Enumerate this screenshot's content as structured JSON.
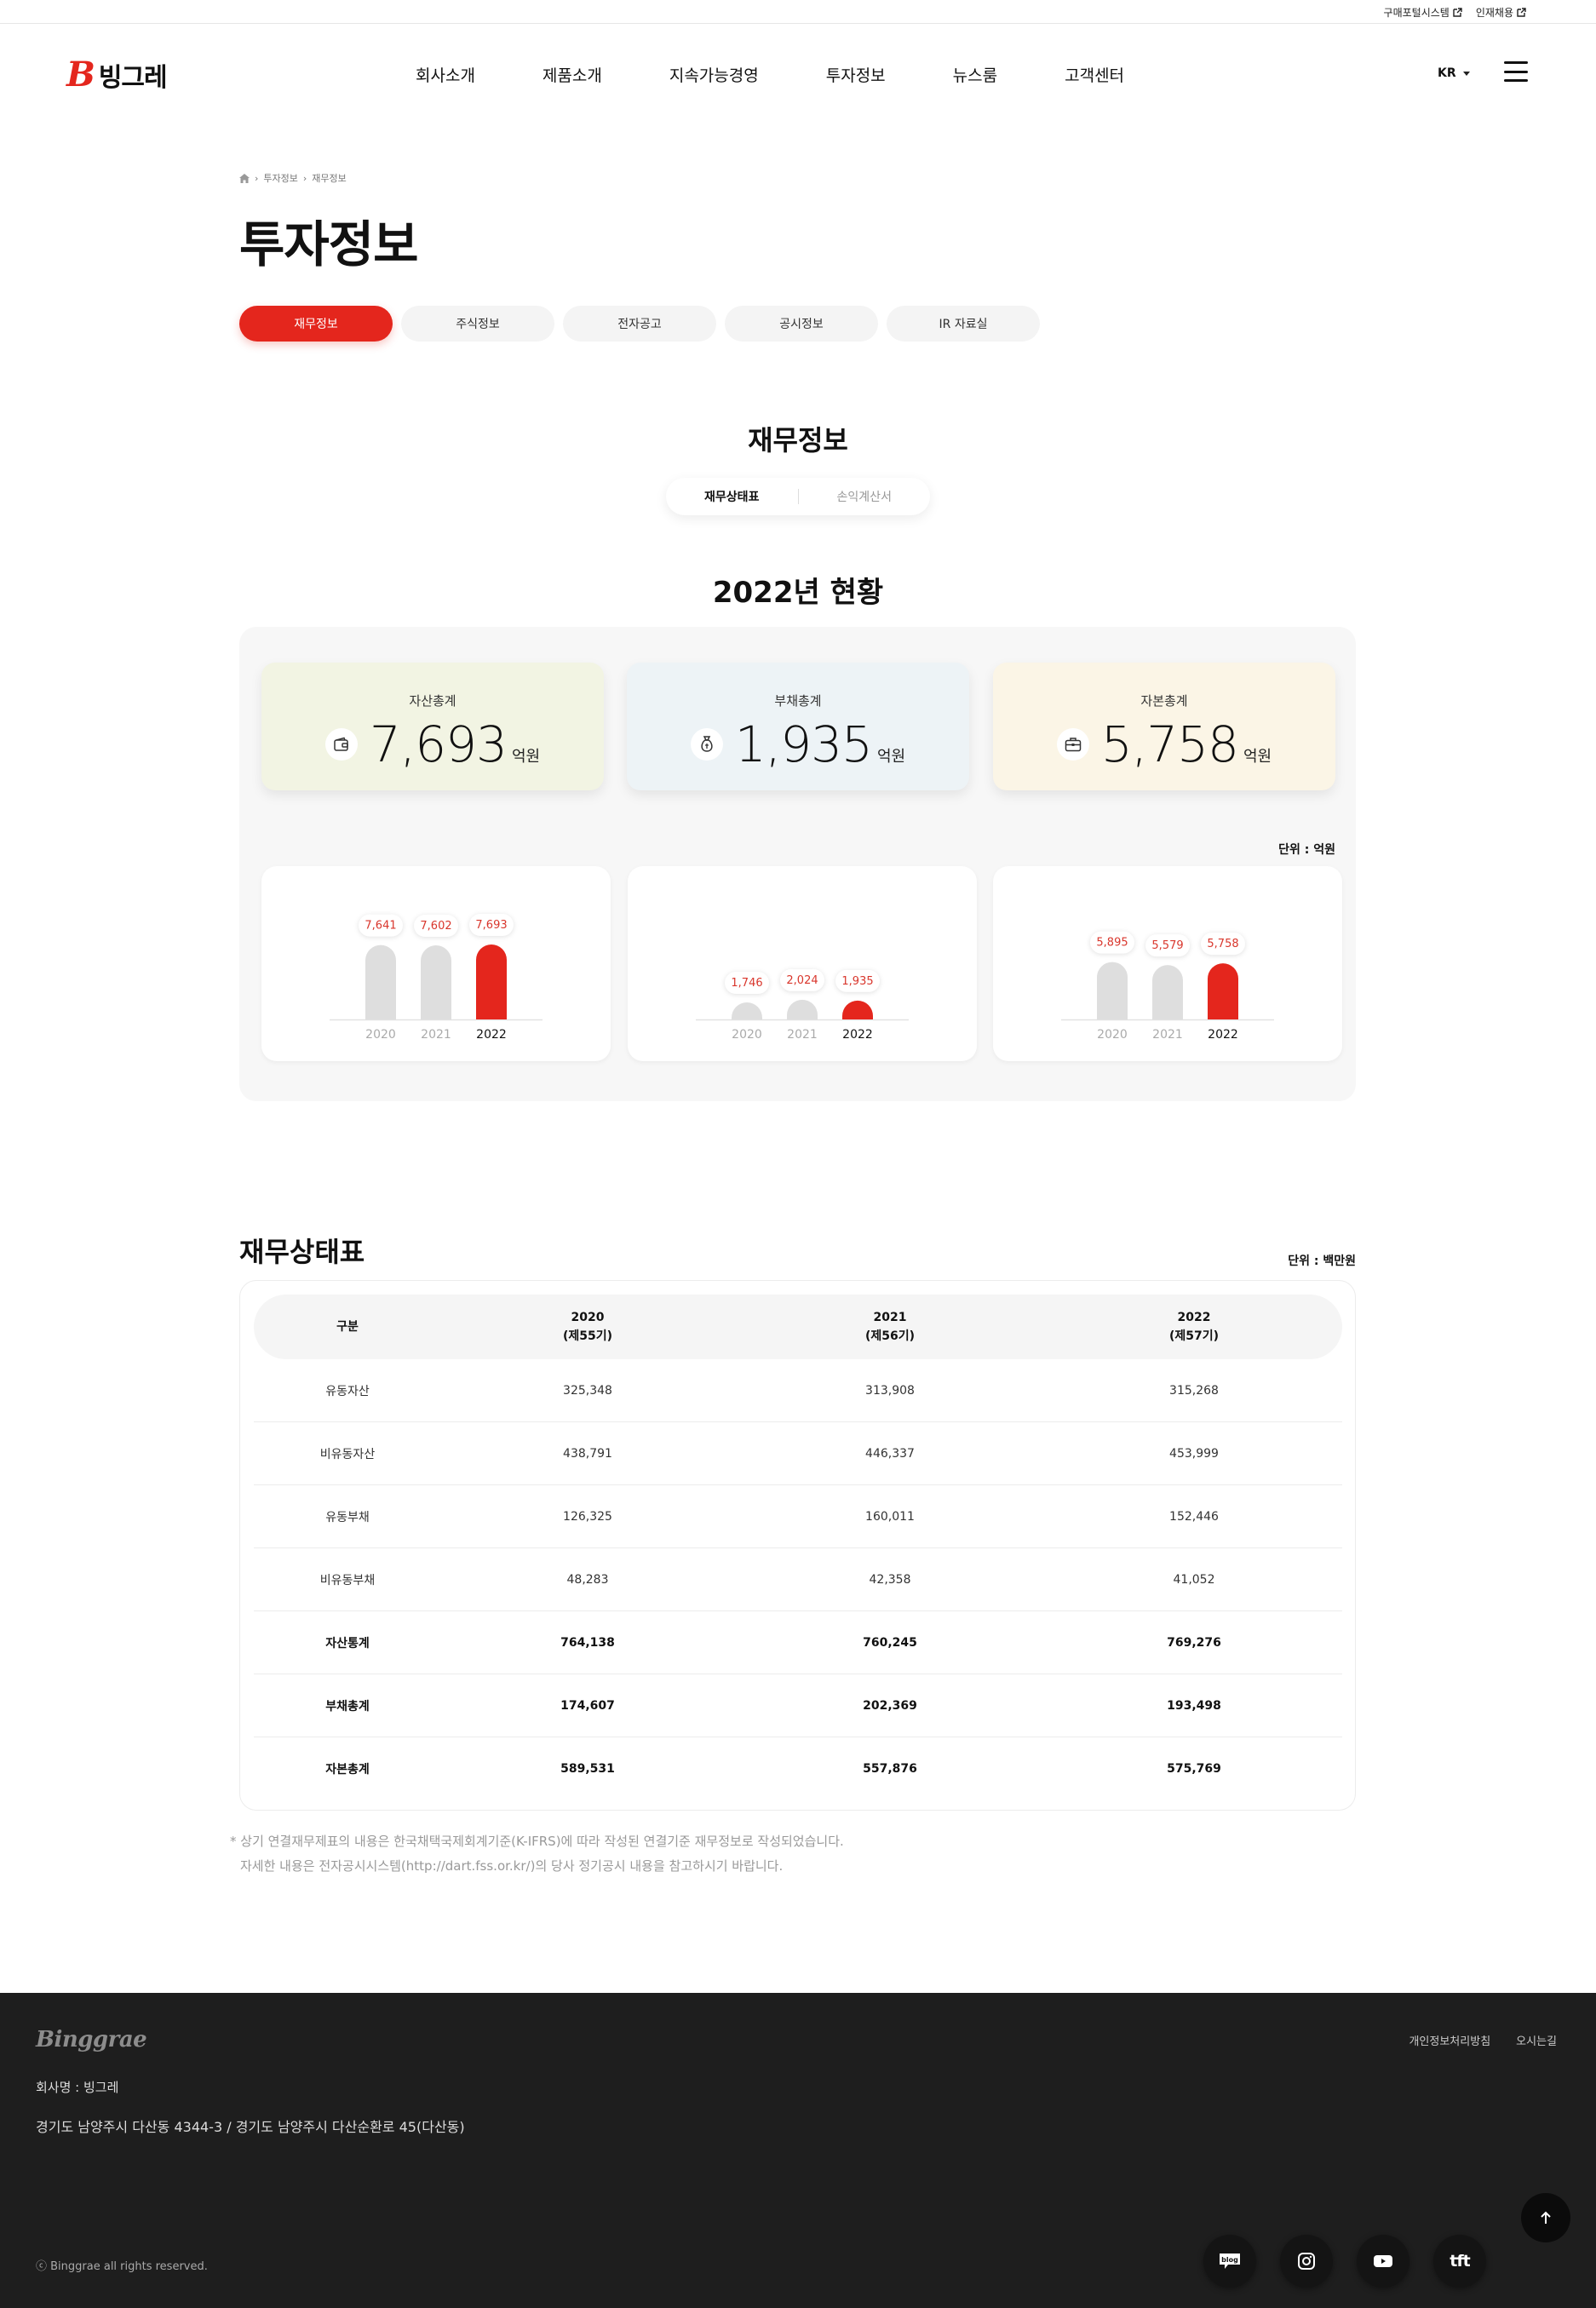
{
  "util": {
    "purchase_portal": "구매포털시스템",
    "recruit": "인재채용"
  },
  "header": {
    "logo_text": "빙그레",
    "nav": [
      "회사소개",
      "제품소개",
      "지속가능경영",
      "투자정보",
      "뉴스룸",
      "고객센터"
    ],
    "lang": "KR"
  },
  "breadcrumb": [
    "투자정보",
    "재무정보"
  ],
  "page_title": "투자정보",
  "tabs": [
    {
      "label": "재무정보",
      "active": true
    },
    {
      "label": "주식정보",
      "active": false
    },
    {
      "label": "전자공고",
      "active": false
    },
    {
      "label": "공시정보",
      "active": false
    },
    {
      "label": "IR 자료실",
      "active": false
    }
  ],
  "section_title": "재무정보",
  "segment": {
    "options": [
      "재무상태표",
      "손익계산서"
    ],
    "active_index": 0
  },
  "status_title": "2022년 현황",
  "kpis": [
    {
      "label": "자산총계",
      "value": "7,693",
      "unit": "억원",
      "icon": "wallet-icon",
      "bg": "#f2f4e3"
    },
    {
      "label": "부채총계",
      "value": "1,935",
      "unit": "억원",
      "icon": "money-bag-icon",
      "bg": "#edf3f6"
    },
    {
      "label": "자본총계",
      "value": "5,758",
      "unit": "억원",
      "icon": "briefcase-icon",
      "bg": "#fbf5e6"
    }
  ],
  "chart_unit": "단위 : 억원",
  "chart_data": [
    {
      "type": "bar",
      "categories": [
        "2020",
        "2021",
        "2022"
      ],
      "values": [
        7641,
        7602,
        7693
      ],
      "labels": [
        "7,641",
        "7,602",
        "7,693"
      ],
      "highlight_color": "#e4261d",
      "base_color": "#dedede"
    },
    {
      "type": "bar",
      "categories": [
        "2020",
        "2021",
        "2022"
      ],
      "values": [
        1746,
        2024,
        1935
      ],
      "labels": [
        "1,746",
        "2,024",
        "1,935"
      ],
      "highlight_color": "#e4261d",
      "base_color": "#dedede"
    },
    {
      "type": "bar",
      "categories": [
        "2020",
        "2021",
        "2022"
      ],
      "values": [
        5895,
        5579,
        5758
      ],
      "labels": [
        "5,895",
        "5,579",
        "5,758"
      ],
      "highlight_color": "#e4261d",
      "base_color": "#dedede"
    }
  ],
  "fs_title": "재무상태표",
  "fs_unit": "단위 : 백만원",
  "table": {
    "headers": [
      {
        "line1": "구분",
        "line2": ""
      },
      {
        "line1": "2020",
        "line2": "(제55기)"
      },
      {
        "line1": "2021",
        "line2": "(제56기)"
      },
      {
        "line1": "2022",
        "line2": "(제57기)"
      }
    ],
    "rows": [
      {
        "cells": [
          "유동자산",
          "325,348",
          "313,908",
          "315,268"
        ],
        "bold": false
      },
      {
        "cells": [
          "비유동자산",
          "438,791",
          "446,337",
          "453,999"
        ],
        "bold": false
      },
      {
        "cells": [
          "유동부채",
          "126,325",
          "160,011",
          "152,446"
        ],
        "bold": false
      },
      {
        "cells": [
          "비유동부채",
          "48,283",
          "42,358",
          "41,052"
        ],
        "bold": false
      },
      {
        "cells": [
          "자산통계",
          "764,138",
          "760,245",
          "769,276"
        ],
        "bold": true
      },
      {
        "cells": [
          "부채총계",
          "174,607",
          "202,369",
          "193,498"
        ],
        "bold": true
      },
      {
        "cells": [
          "자본총계",
          "589,531",
          "557,876",
          "575,769"
        ],
        "bold": true
      }
    ]
  },
  "footnote": {
    "line1": "* 상기 연결재무제표의 내용은 한국채택국제회계기준(K-IFRS)에 따라 작성된 연결기준 재무정보로 작성되었습니다.",
    "line2": "자세한 내용은 전자공시시스템(http://dart.fss.or.kr/)의 당사 정기공시 내용을 참고하시기 바랍니다."
  },
  "footer": {
    "logo": "Binggrae",
    "links": [
      "개인정보처리방침",
      "오시는길"
    ],
    "company": "회사명 : 빙그레",
    "address": "경기도 남양주시 다산동 4344-3 / 경기도 남양주시 다산순환로 45(다산동)",
    "copyright": "ⓒ Binggrae all rights reserved.",
    "sns": [
      "blog-icon",
      "instagram-icon",
      "youtube-icon",
      "tft-icon"
    ],
    "blog_label": "blog",
    "tft_label": "tft"
  }
}
